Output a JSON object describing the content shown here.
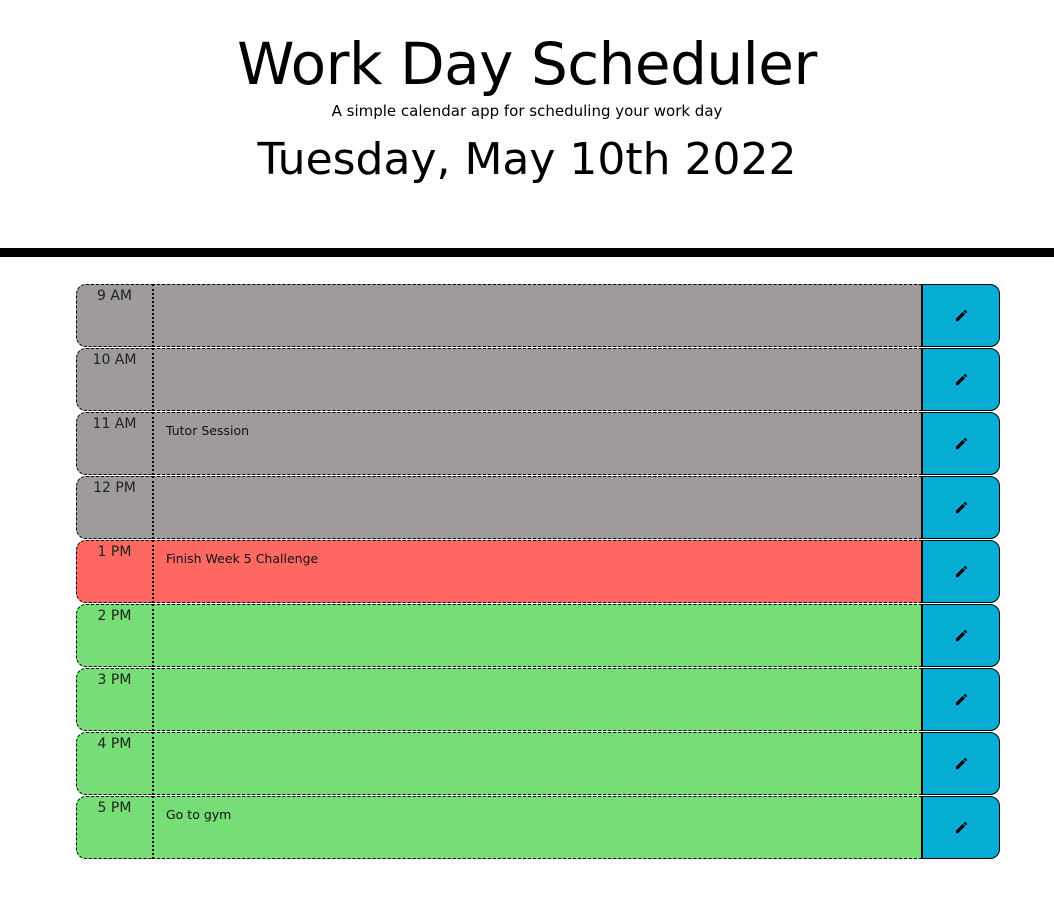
{
  "header": {
    "title": "Work Day Scheduler",
    "subtitle": "A simple calendar app for scheduling your work day",
    "current_date": "Tuesday, May 10th 2022"
  },
  "colors": {
    "past": "#9e9b9a",
    "present": "#ff6961",
    "future": "#77dd77",
    "save_button": "#06aed5"
  },
  "schedule": {
    "save_icon": "pencil-icon",
    "blocks": [
      {
        "hour": "9 AM",
        "text": "",
        "state": "past"
      },
      {
        "hour": "10 AM",
        "text": "",
        "state": "past"
      },
      {
        "hour": "11 AM",
        "text": "Tutor Session",
        "state": "past"
      },
      {
        "hour": "12 PM",
        "text": "",
        "state": "past"
      },
      {
        "hour": "1 PM",
        "text": "Finish Week 5 Challenge",
        "state": "present"
      },
      {
        "hour": "2 PM",
        "text": "",
        "state": "future"
      },
      {
        "hour": "3 PM",
        "text": "",
        "state": "future"
      },
      {
        "hour": "4 PM",
        "text": "",
        "state": "future"
      },
      {
        "hour": "5 PM",
        "text": "Go to gym",
        "state": "future"
      }
    ]
  }
}
